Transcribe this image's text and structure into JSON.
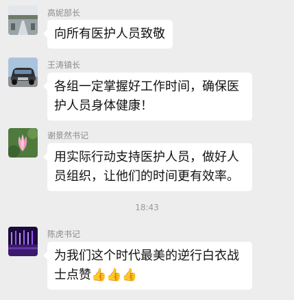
{
  "messages": [
    {
      "sender": "高妮部长",
      "text": "向所有医护人员致敬",
      "avatar": "landscape-photo-avatar"
    },
    {
      "sender": "王涛镇长",
      "line1": "各组一定掌握好工作时间，确保医",
      "line2": "护人员身体健康！",
      "avatar": "car-photo-avatar"
    },
    {
      "sender": "谢景然书记",
      "line1": "用实际行动支持医护人员，做好人",
      "line2": "员组织，让他们的时间更有效率。",
      "avatar": "lotus-flower-avatar"
    },
    {
      "sender": "陈虎书记",
      "line1": "为我们这个时代最美的逆行白衣战",
      "line2": "士点赞",
      "emoji": "👍👍👍",
      "avatar": "purple-lights-avatar"
    }
  ],
  "timestamp": "18:43",
  "colors": {
    "background": "#ededed",
    "bubble": "#ffffff",
    "sender_name": "#8a8a8a"
  }
}
